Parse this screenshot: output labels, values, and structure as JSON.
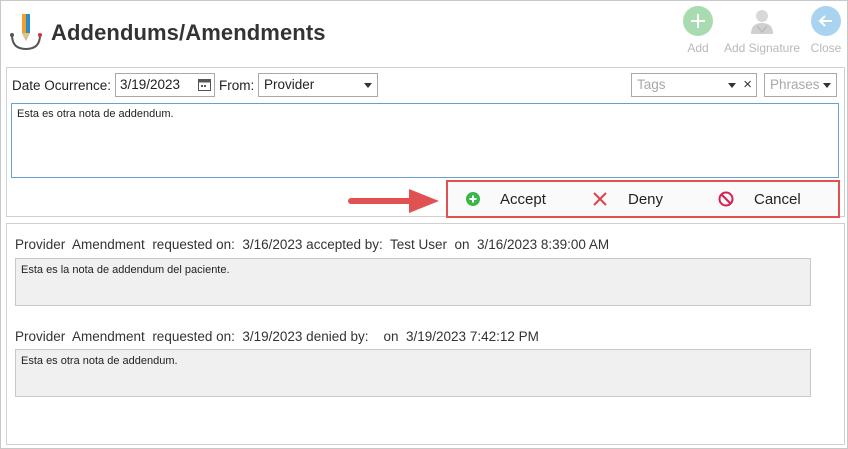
{
  "header": {
    "title": "Addendums/Amendments",
    "toolbar": {
      "add_label": "Add",
      "add_signature_label": "Add Signature",
      "close_label": "Close"
    }
  },
  "form": {
    "date_label": "Date Ocurrence:",
    "date_value": "3/19/2023",
    "from_label": "From:",
    "from_value": "Provider",
    "tags_placeholder": "Tags",
    "phrases_placeholder": "Phrases",
    "note_value": "Esta es otra nota de addendum."
  },
  "actions": {
    "accept_label": "Accept",
    "deny_label": "Deny",
    "cancel_label": "Cancel"
  },
  "history": [
    {
      "header": "Provider  Amendment  requested on:  3/16/2023 accepted by:  Test User  on  3/16/2023 8:39:00 AM",
      "note": "Esta es la nota de addendum del paciente."
    },
    {
      "header": "Provider  Amendment  requested on:  3/19/2023 denied by:    on  3/19/2023 7:42:12 PM",
      "note": "Esta es otra nota de addendum."
    }
  ],
  "colors": {
    "accent_red": "#e05252",
    "accept_green": "#3cb54a",
    "deny_red": "#e0404a",
    "cancel_magenta": "#d6204f",
    "toolbar_disabled": "#b9b9b9"
  }
}
